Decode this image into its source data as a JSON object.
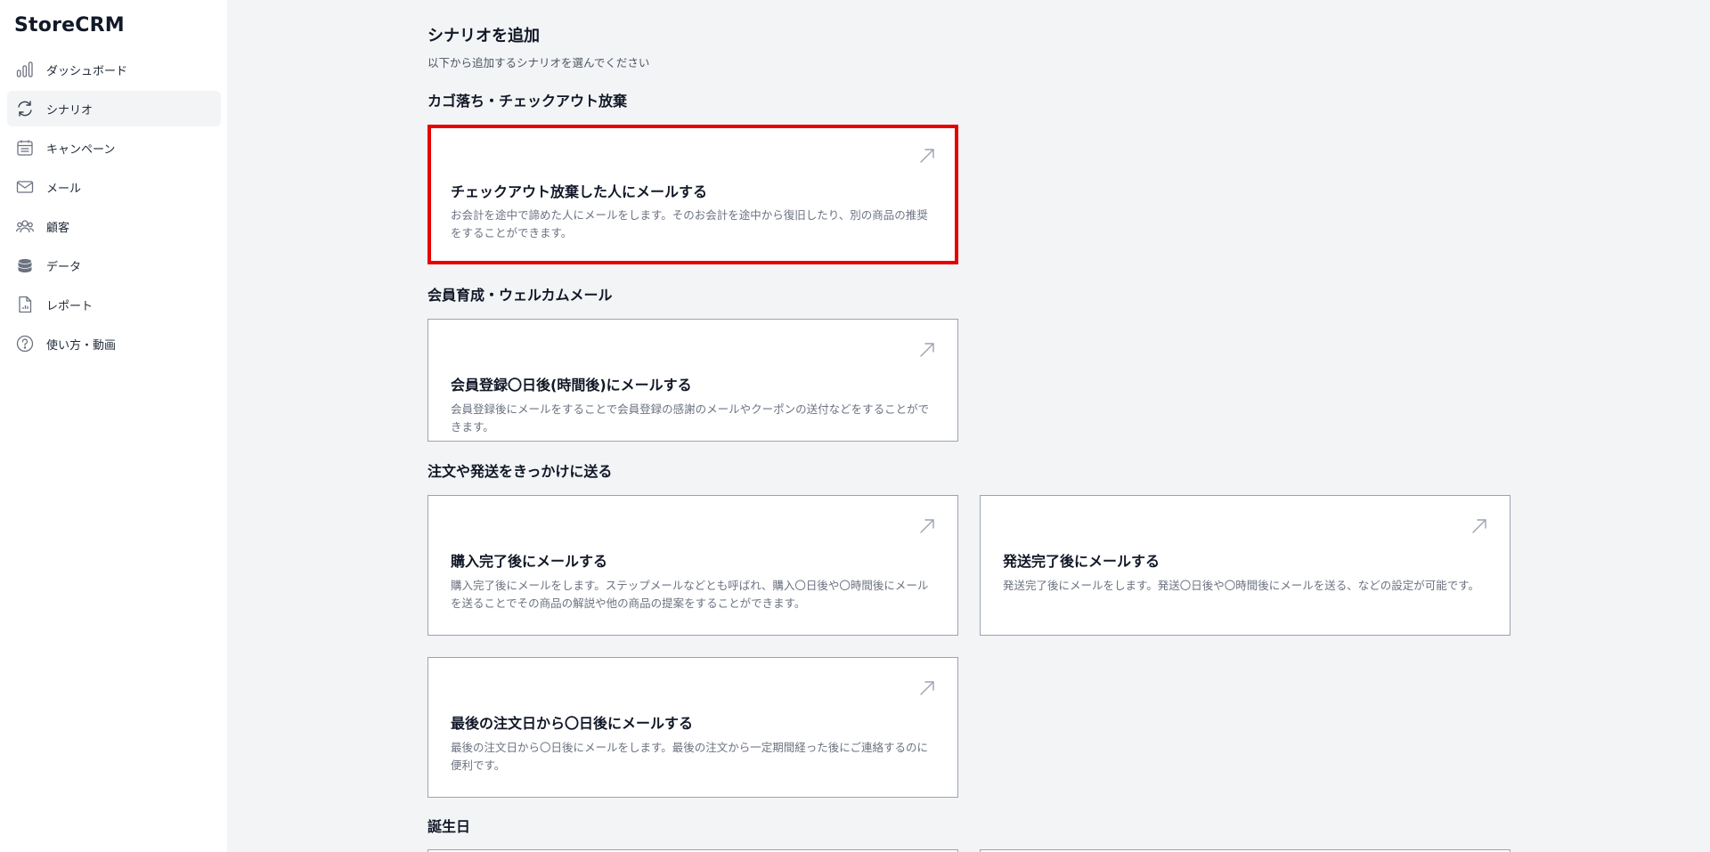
{
  "brand": "StoreCRM",
  "sidebar": {
    "items": [
      {
        "label": "ダッシュボード",
        "icon": "bar-chart-icon"
      },
      {
        "label": "シナリオ",
        "icon": "refresh-icon",
        "active": true
      },
      {
        "label": "キャンペーン",
        "icon": "calendar-icon"
      },
      {
        "label": "メール",
        "icon": "mail-icon"
      },
      {
        "label": "顧客",
        "icon": "users-icon"
      },
      {
        "label": "データ",
        "icon": "database-icon"
      },
      {
        "label": "レポート",
        "icon": "report-icon"
      },
      {
        "label": "使い方・動画",
        "icon": "help-icon"
      }
    ]
  },
  "main": {
    "title": "シナリオを追加",
    "subtitle": "以下から追加するシナリオを選んでください",
    "sections": [
      {
        "heading": "カゴ落ち・チェックアウト放棄",
        "cards": [
          {
            "title": "チェックアウト放棄した人にメールする",
            "description": "お会計を途中で諦めた人にメールをします。そのお会計を途中から復旧したり、別の商品の推奨をすることができます。",
            "selected": true
          }
        ]
      },
      {
        "heading": "会員育成・ウェルカムメール",
        "cards": [
          {
            "title": "会員登録〇日後(時間後)にメールする",
            "description": "会員登録後にメールをすることで会員登録の感謝のメールやクーポンの送付などをすることができます。"
          }
        ]
      },
      {
        "heading": "注文や発送をきっかけに送る",
        "cards": [
          {
            "title": "購入完了後にメールする",
            "description": "購入完了後にメールをします。ステップメールなどとも呼ばれ、購入〇日後や〇時間後にメールを送ることでその商品の解説や他の商品の提案をすることができます。"
          },
          {
            "title": "発送完了後にメールする",
            "description": "発送完了後にメールをします。発送〇日後や〇時間後にメールを送る、などの設定が可能です。"
          },
          {
            "title": "最後の注文日から〇日後にメールする",
            "description": "最後の注文日から〇日後にメールをします。最後の注文から一定期間経った後にご連絡するのに便利です。"
          }
        ]
      },
      {
        "heading": "誕生日",
        "cards": []
      }
    ]
  },
  "colors": {
    "selected_border": "#e60000",
    "background": "#f3f4f6",
    "card_border": "#9ca3af"
  }
}
